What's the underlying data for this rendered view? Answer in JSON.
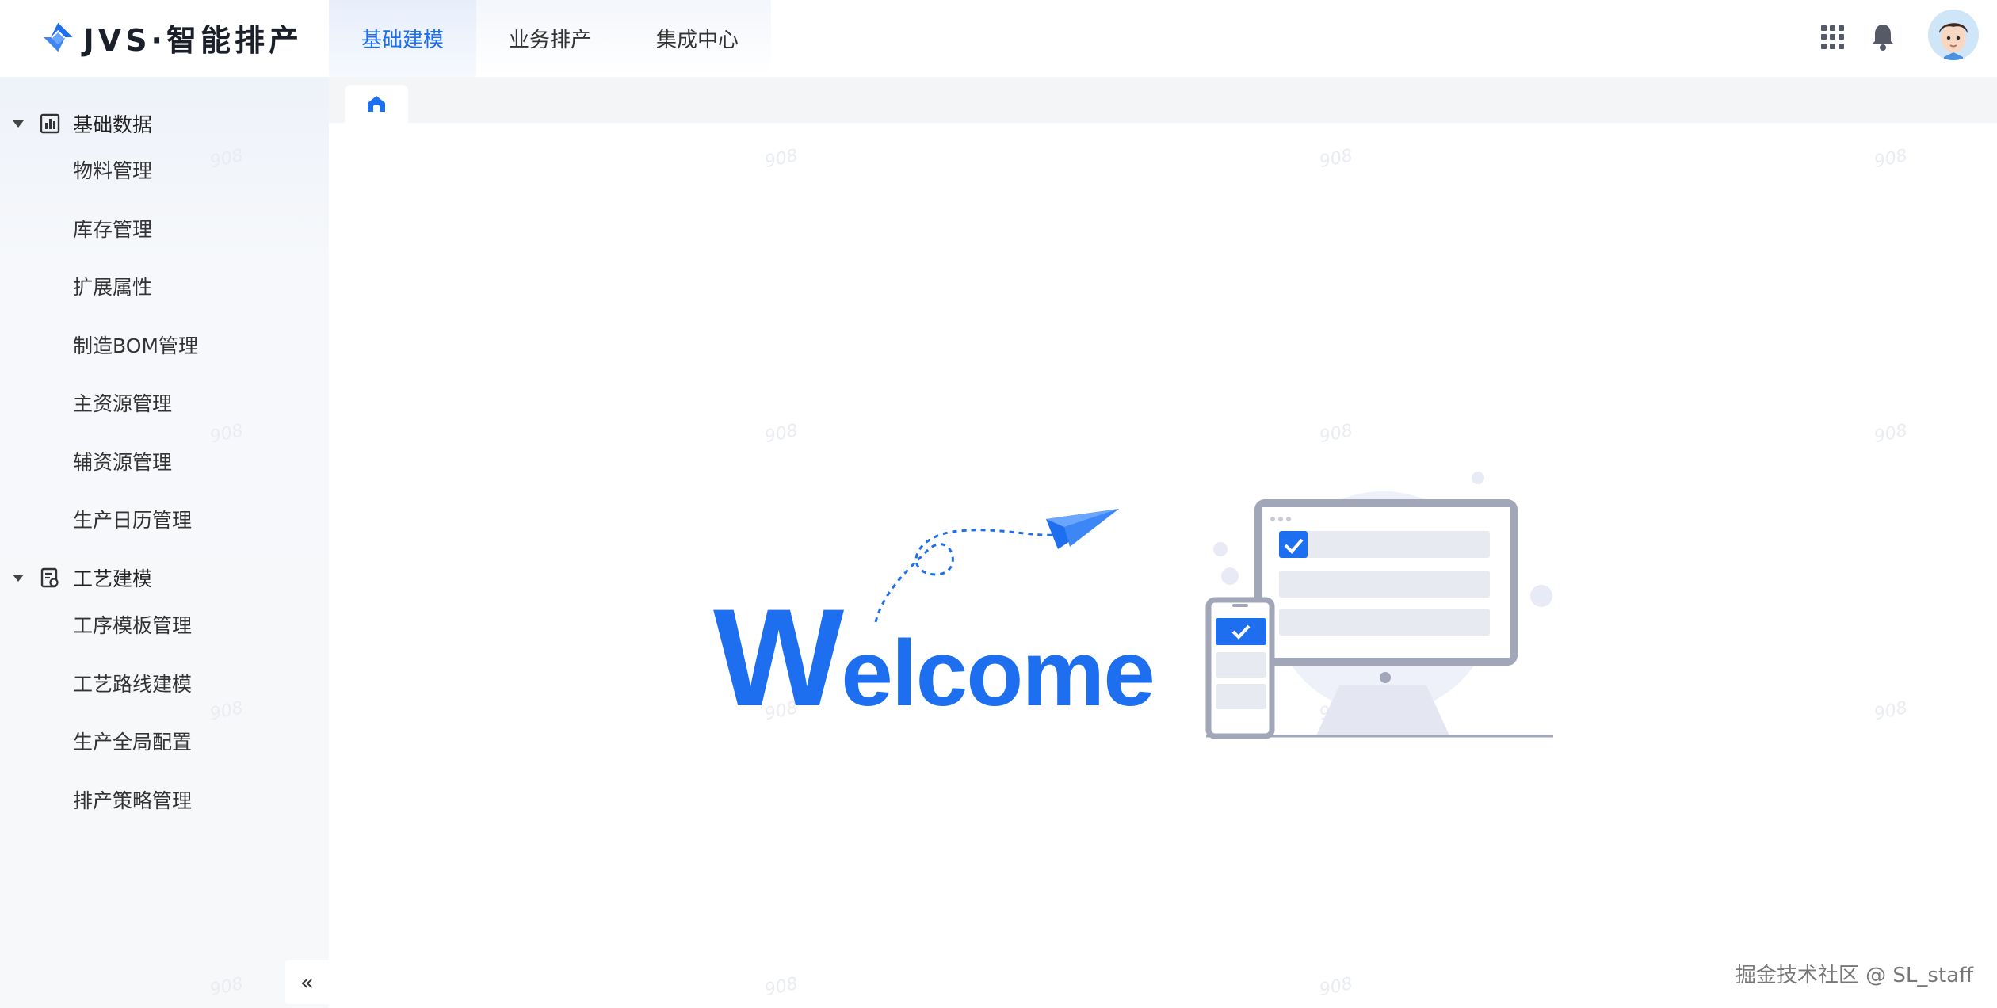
{
  "header": {
    "logo_text": "JVS·智能排产",
    "tabs": [
      {
        "label": "基础建模",
        "active": true
      },
      {
        "label": "业务排产",
        "active": false
      },
      {
        "label": "集成中心",
        "active": false
      }
    ],
    "icons": [
      "apps-grid-icon",
      "bell-icon",
      "avatar"
    ]
  },
  "sidebar": {
    "groups": [
      {
        "label": "基础数据",
        "icon": "chart-icon",
        "expanded": true,
        "items": [
          {
            "label": "物料管理"
          },
          {
            "label": "库存管理"
          },
          {
            "label": "扩展属性"
          },
          {
            "label": "制造BOM管理"
          },
          {
            "label": "主资源管理"
          },
          {
            "label": "辅资源管理"
          },
          {
            "label": "生产日历管理"
          }
        ]
      },
      {
        "label": "工艺建模",
        "icon": "process-icon",
        "expanded": true,
        "items": [
          {
            "label": "工序模板管理"
          },
          {
            "label": "工艺路线建模"
          },
          {
            "label": "生产全局配置"
          },
          {
            "label": "排产策略管理"
          }
        ]
      }
    ],
    "collapse_label": "«"
  },
  "tabbar": {
    "home_icon": "home-icon"
  },
  "main": {
    "welcome_big": "W",
    "welcome_rest": "elcome",
    "watermark": "908"
  },
  "footer": {
    "credit": "掘金技术社区 @ SL_staff"
  },
  "colors": {
    "accent": "#1e6ff0",
    "sidebar_bg": "#f7f8fa",
    "tabbar_bg": "#f4f5f7"
  }
}
